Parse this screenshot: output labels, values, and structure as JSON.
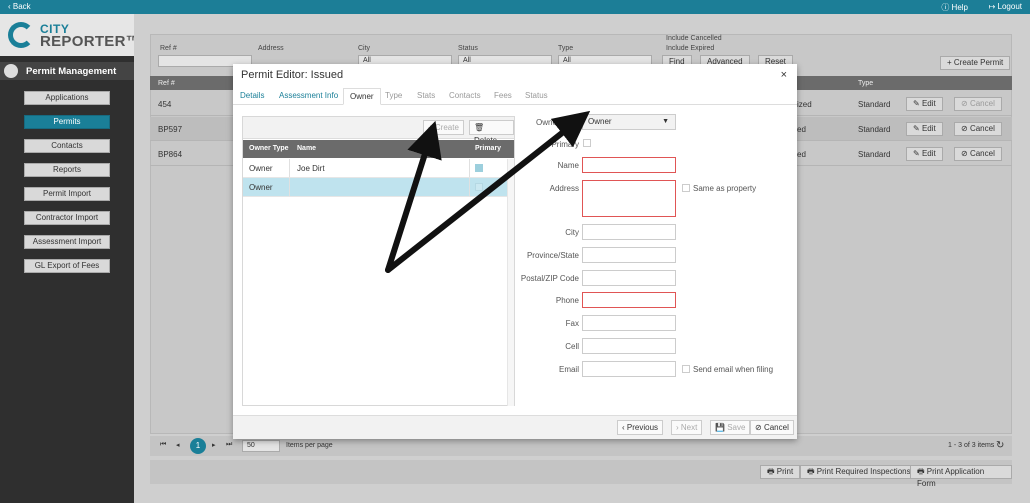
{
  "topbar": {
    "back": "‹ Back",
    "help": "Help",
    "logout": "Logout"
  },
  "logo": {
    "line1": "CITY",
    "line2": "REPORTER™"
  },
  "sidebar": {
    "section_title": "Permit Management",
    "items": [
      {
        "label": "Applications",
        "active": false
      },
      {
        "label": "Permits",
        "active": true
      },
      {
        "label": "Contacts",
        "active": false
      },
      {
        "label": "Reports",
        "active": false
      },
      {
        "label": "Permit Import",
        "active": false
      },
      {
        "label": "Contractor Import",
        "active": false
      },
      {
        "label": "Assessment Import",
        "active": false
      },
      {
        "label": "GL Export of Fees",
        "active": false
      }
    ]
  },
  "filters": {
    "ref_label": "Ref #",
    "address_label": "Address",
    "city_label": "City",
    "city_value": "All",
    "status_label": "Status",
    "status_value": "All",
    "type_label": "Type",
    "type_value": "All",
    "include_cancelled": "Include Cancelled",
    "include_expired": "Include Expired",
    "find": "Find",
    "advanced": "Advanced",
    "reset": "Reset",
    "create_permit": "+ Create Permit"
  },
  "grid": {
    "head_ref": "Ref #",
    "head_type": "Type",
    "rows": [
      {
        "ref": "454",
        "status": "ized",
        "type": "Standard",
        "edit": "Edit",
        "cancel": "Cancel"
      },
      {
        "ref": "BP597",
        "status": "ed",
        "type": "Standard",
        "edit": "Edit",
        "cancel": "Cancel"
      },
      {
        "ref": "BP864",
        "status": "ed",
        "type": "Standard",
        "edit": "Edit",
        "cancel": "Cancel"
      }
    ],
    "page_size": "50",
    "items_per_page": "Items per page",
    "page_number": "1",
    "count": "1 - 3 of 3 items"
  },
  "bottom_buttons": {
    "print": "Print",
    "print_inspections": "Print Required Inspections",
    "print_form": "Print Application Form"
  },
  "modal": {
    "title": "Permit Editor: Issued",
    "close": "×",
    "tabs": [
      "Details",
      "Assessment Info",
      "Owner",
      "Type",
      "Stats",
      "Contacts",
      "Fees",
      "Status"
    ],
    "active_tab": "Owner",
    "toolbar": {
      "create": "+ Create",
      "delete": "Delete"
    },
    "table_head": {
      "owner_type": "Owner Type",
      "name": "Name",
      "primary": "Primary"
    },
    "table_rows": [
      {
        "owner_type": "Owner",
        "name": "Joe Dirt",
        "primary": true
      },
      {
        "owner_type": "Owner",
        "name": "",
        "primary": false
      }
    ],
    "form": {
      "owner_type_label": "Owner Type",
      "owner_type_value": "Owner",
      "primary_label": "Primary",
      "name_label": "Name",
      "address_label": "Address",
      "same_as_property": "Same as property",
      "city_label": "City",
      "province_label": "Province/State",
      "postal_label": "Postal/ZIP Code",
      "phone_label": "Phone",
      "fax_label": "Fax",
      "cell_label": "Cell",
      "email_label": "Email",
      "send_email": "Send email when filing"
    },
    "footer": {
      "previous": "Previous",
      "next": "Next",
      "save": "Save",
      "cancel": "Cancel"
    }
  },
  "colors": {
    "accent": "#1a7f98",
    "required_border": "#e05555",
    "selected_row": "#bfe3ee"
  }
}
